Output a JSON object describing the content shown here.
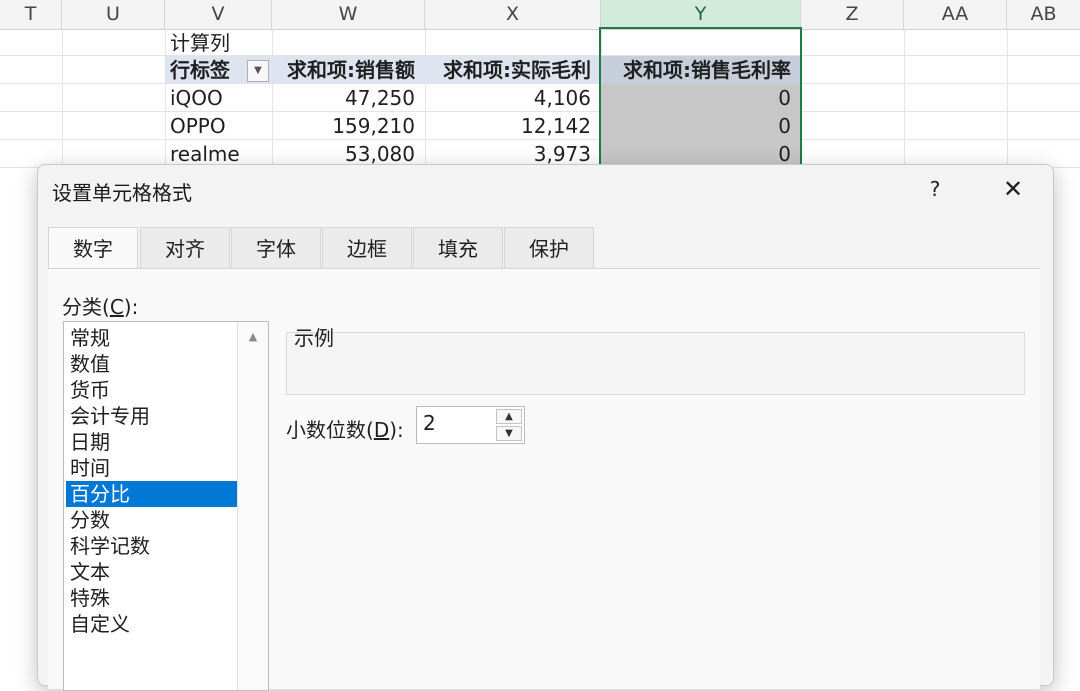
{
  "columns": [
    "T",
    "U",
    "V",
    "W",
    "X",
    "Y",
    "Z",
    "AA",
    "AB"
  ],
  "selected_column": "Y",
  "pivot": {
    "calc_col_label": "计算列",
    "headers": [
      "行标签",
      "求和项:销售额",
      "求和项:实际毛利",
      "求和项:销售毛利率"
    ],
    "rows": [
      [
        "iQOO",
        "47,250",
        "4,106",
        "0"
      ],
      [
        "OPPO",
        "159,210",
        "12,142",
        "0"
      ],
      [
        "realme",
        "53,080",
        "3,973",
        "0"
      ]
    ]
  },
  "dialog": {
    "title": "设置单元格格式",
    "help_label": "?",
    "close_label": "✕",
    "tabs": [
      "数字",
      "对齐",
      "字体",
      "边框",
      "填充",
      "保护"
    ],
    "active_tab": "数字",
    "category_label_prefix": "分类(",
    "category_label_key": "C",
    "category_label_suffix": "):",
    "categories": [
      "常规",
      "数值",
      "货币",
      "会计专用",
      "日期",
      "时间",
      "百分比",
      "分数",
      "科学记数",
      "文本",
      "特殊",
      "自定义"
    ],
    "selected_category": "百分比",
    "sample_label": "示例",
    "decimal_label_prefix": "小数位数(",
    "decimal_label_key": "D",
    "decimal_label_suffix": "):",
    "decimal_value": "2"
  },
  "icons": {
    "dropdown": "dropdown-arrow-icon",
    "spin_up": "spin-up-icon",
    "spin_down": "spin-down-icon",
    "scroll_up": "scroll-up-icon"
  },
  "colors": {
    "selected_col_header": "#d3ebdd",
    "selection_border": "#1f7a45",
    "pivot_header_bg": "#dde4f0",
    "gray_cells": "#c7c7c7",
    "list_selection": "#0078d4"
  }
}
